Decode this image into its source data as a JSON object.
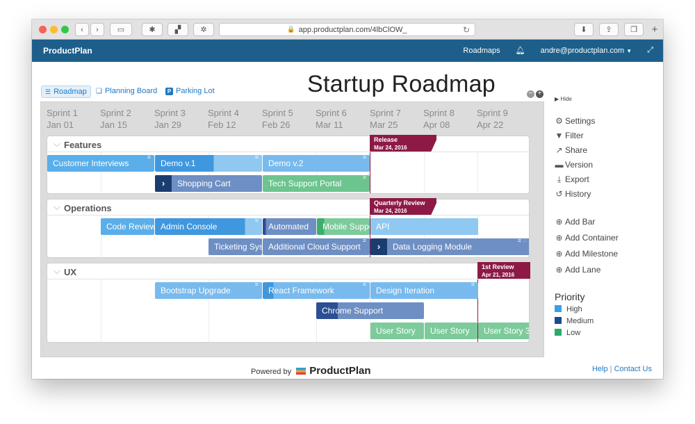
{
  "browser": {
    "url": "app.productplan.com/4lbClOW_"
  },
  "nav": {
    "brand": "ProductPlan",
    "roadmaps": "Roadmaps",
    "user": "andre@productplan.com"
  },
  "views": {
    "roadmap": "Roadmap",
    "planning_board": "Planning Board",
    "parking_lot": "Parking Lot"
  },
  "title": "Startup Roadmap",
  "sprints": [
    {
      "name": "Sprint 1",
      "date": "Jan 01"
    },
    {
      "name": "Sprint 2",
      "date": "Jan 15"
    },
    {
      "name": "Sprint 3",
      "date": "Jan 29"
    },
    {
      "name": "Sprint 4",
      "date": "Feb 12"
    },
    {
      "name": "Sprint 5",
      "date": "Feb 26"
    },
    {
      "name": "Sprint 6",
      "date": "Mar 11"
    },
    {
      "name": "Sprint 7",
      "date": "Mar 25"
    },
    {
      "name": "Sprint 8",
      "date": "Apr 08"
    },
    {
      "name": "Sprint 9",
      "date": "Apr 22"
    }
  ],
  "lanes": {
    "features": "Features",
    "operations": "Operations",
    "ux": "UX"
  },
  "bars": {
    "customer_interviews": "Customer Interviews",
    "demo_v1": "Demo v.1",
    "demo_v2": "Demo v.2",
    "shopping_cart": "Shopping Cart",
    "tech_support_portal": "Tech Support Portal",
    "code_review": "Code Review",
    "admin_console": "Admin Console",
    "automated": "Automated",
    "mobile_support": "Mobile Support",
    "api": "API",
    "ticketing": "Ticketing System",
    "cloud_support": "Additional Cloud Support",
    "data_logging": "Data Logging Module",
    "bootstrap_upgrade": "Bootstrap Upgrade",
    "react_framework": "React Framework",
    "design_iteration": "Design Iteration",
    "chrome_support": "Chrome Support",
    "user_story_1": "User Story",
    "user_story_2": "User Story",
    "user_story_3": "User Story 3"
  },
  "milestones": [
    {
      "name": "Release",
      "date": "Mar 24, 2016"
    },
    {
      "name": "Quarterly Review",
      "date": "Mar 24, 2016"
    },
    {
      "name": "1st Review",
      "date": "Apr 21, 2016"
    }
  ],
  "sidebar": {
    "hide": "Hide",
    "settings": "Settings",
    "filter": "Filter",
    "share": "Share",
    "version": "Version",
    "export": "Export",
    "history": "History",
    "add_bar": "Add Bar",
    "add_container": "Add Container",
    "add_milestone": "Add Milestone",
    "add_lane": "Add Lane",
    "priority_title": "Priority",
    "priorities": [
      {
        "label": "High",
        "color": "#3aa0e6"
      },
      {
        "label": "Medium",
        "color": "#1d4a8f"
      },
      {
        "label": "Low",
        "color": "#2aab6b"
      }
    ]
  },
  "footer": {
    "powered_by": "Powered by",
    "logo": "ProductPlan",
    "help": "Help",
    "contact": "Contact Us"
  },
  "colors": {
    "high": "#5aaee9",
    "medium": "#3d64a8",
    "low": "#6cc48e",
    "milestone": "#8d1a46",
    "nav": "#1d5f8a"
  }
}
